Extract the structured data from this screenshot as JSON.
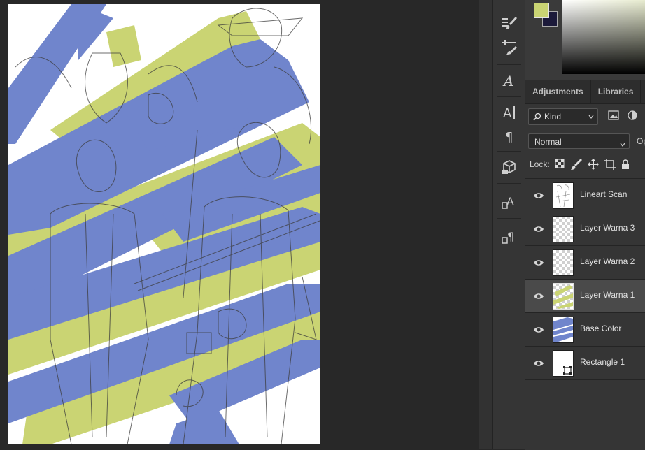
{
  "colors": {
    "workspace_bg": "#282828",
    "panel_bg": "#353535",
    "foreground_color": "#cad473",
    "background_color": "#1c1a3a",
    "stroke_blue": "#7085cc",
    "stroke_yellow": "#cad473"
  },
  "tools": [
    {
      "icon": "brush-settings-icon"
    },
    {
      "icon": "clone-source-icon"
    },
    {
      "icon": "character-style-icon"
    },
    {
      "icon": "character-panel-icon"
    },
    {
      "icon": "paragraph-icon"
    },
    {
      "icon": "3d-icon"
    },
    {
      "icon": "character-styles-icon"
    },
    {
      "icon": "paragraph-styles-icon"
    }
  ],
  "layers_panel": {
    "tabs": [
      {
        "label": "Adjustments"
      },
      {
        "label": "Libraries"
      }
    ],
    "filter_kind": "Kind",
    "blend_mode": "Normal",
    "opacity_label": "Op",
    "lock_label": "Lock:",
    "layers": [
      {
        "name": "Lineart Scan",
        "visible": true,
        "selected": false,
        "thumb": "lineart"
      },
      {
        "name": "Layer Warna 3",
        "visible": true,
        "selected": false,
        "thumb": "transparent"
      },
      {
        "name": "Layer Warna 2",
        "visible": true,
        "selected": false,
        "thumb": "transparent"
      },
      {
        "name": "Layer Warna 1",
        "visible": true,
        "selected": true,
        "thumb": "yellow-strokes"
      },
      {
        "name": "Base Color",
        "visible": true,
        "selected": false,
        "thumb": "blue-base"
      },
      {
        "name": "Rectangle 1",
        "visible": true,
        "selected": false,
        "thumb": "white-shape"
      }
    ]
  }
}
